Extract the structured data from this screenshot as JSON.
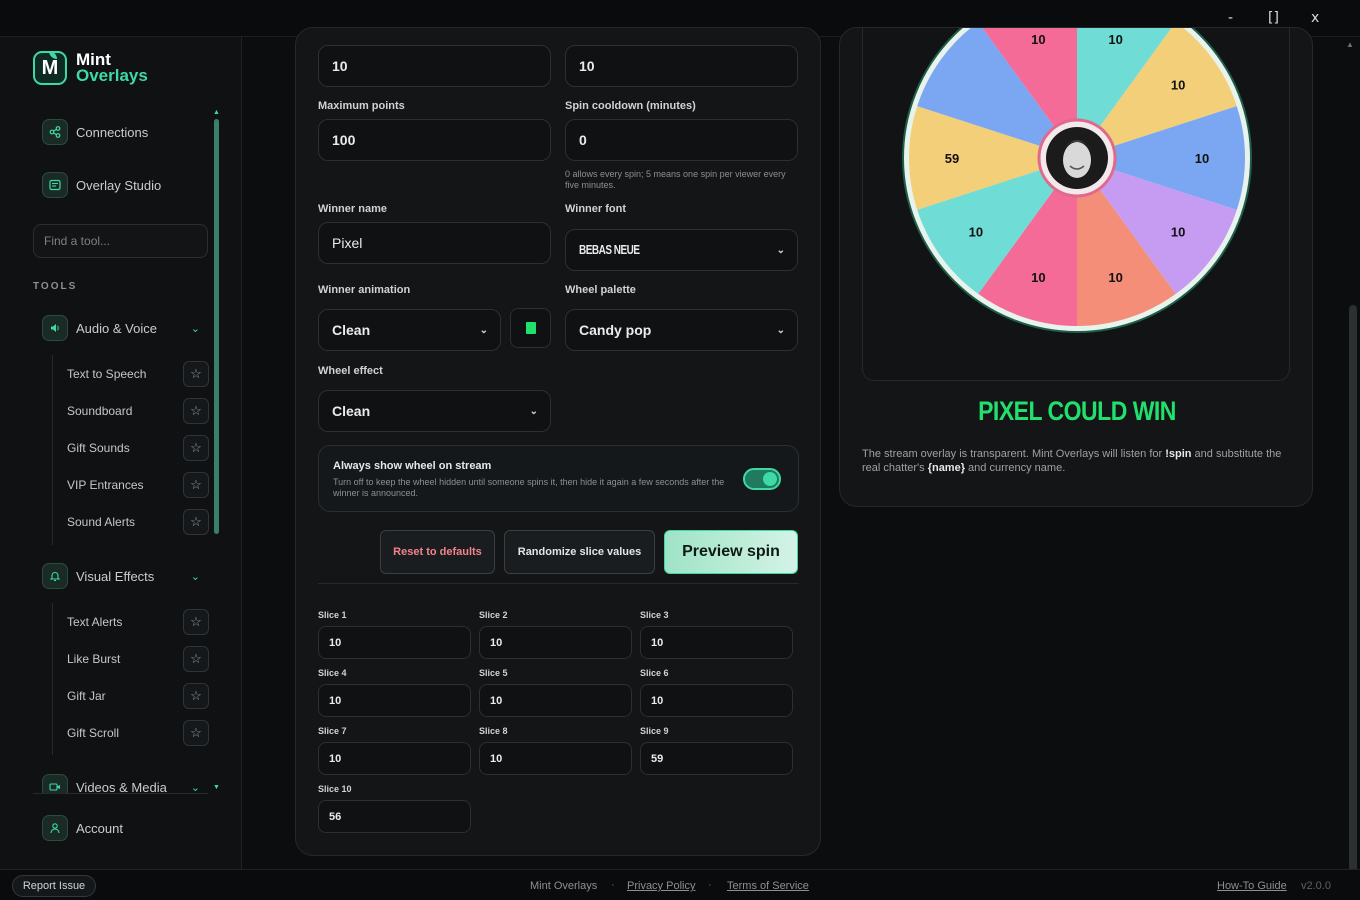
{
  "window": {
    "minimize": "-",
    "maximize": "[]",
    "close": "x"
  },
  "brand": {
    "logo_letter": "M",
    "line1": "Mint",
    "line2": "Overlays"
  },
  "nav": {
    "connections": "Connections",
    "overlay_studio": "Overlay Studio",
    "account": "Account"
  },
  "search": {
    "placeholder": "Find a tool..."
  },
  "tools_title": "TOOLS",
  "groups": {
    "audio": {
      "label": "Audio & Voice",
      "items": [
        "Text to Speech",
        "Soundboard",
        "Gift Sounds",
        "VIP Entrances",
        "Sound Alerts"
      ]
    },
    "visual": {
      "label": "Visual Effects",
      "items": [
        "Text Alerts",
        "Like Burst",
        "Gift Jar",
        "Gift Scroll"
      ]
    },
    "videos": {
      "label": "Videos & Media"
    }
  },
  "form": {
    "top_left_value": "10",
    "top_right_value": "10",
    "max_points_label": "Maximum points",
    "max_points_value": "100",
    "cooldown_label": "Spin cooldown (minutes)",
    "cooldown_value": "0",
    "cooldown_help": "0 allows every spin; 5 means one spin per viewer every five minutes.",
    "winner_name_label": "Winner name",
    "winner_name_value": "Pixel",
    "winner_font_label": "Winner font",
    "winner_font_value": "BEBAS NEUE",
    "winner_animation_label": "Winner animation",
    "winner_animation_value": "Clean",
    "animation_color": "#22e06e",
    "wheel_palette_label": "Wheel palette",
    "wheel_palette_value": "Candy pop",
    "wheel_effect_label": "Wheel effect",
    "wheel_effect_value": "Clean",
    "toggle_title": "Always show wheel on stream",
    "toggle_desc": "Turn off to keep the wheel hidden until someone spins it, then hide it again a few seconds after the winner is announced.",
    "toggle_on": true,
    "reset_label": "Reset to defaults",
    "randomize_label": "Randomize slice values",
    "preview_label": "Preview spin",
    "slices": [
      {
        "label": "Slice 1",
        "value": "10"
      },
      {
        "label": "Slice 2",
        "value": "10"
      },
      {
        "label": "Slice 3",
        "value": "10"
      },
      {
        "label": "Slice 4",
        "value": "10"
      },
      {
        "label": "Slice 5",
        "value": "10"
      },
      {
        "label": "Slice 6",
        "value": "10"
      },
      {
        "label": "Slice 7",
        "value": "10"
      },
      {
        "label": "Slice 8",
        "value": "10"
      },
      {
        "label": "Slice 9",
        "value": "59"
      },
      {
        "label": "Slice 10",
        "value": "56"
      }
    ]
  },
  "preview": {
    "wheel_labels": [
      "59",
      "10",
      "10",
      "10",
      "10",
      "10",
      "10",
      "10",
      "10"
    ],
    "wheel_colors": [
      "#f2cf78",
      "#7aa6f2",
      "#f56b97",
      "#6fdcd5",
      "#f2cf78",
      "#7aa6f2",
      "#c59cf2",
      "#f58e78",
      "#f56b97",
      "#6fdcd5"
    ],
    "winner_text": "PIXEL COULD WIN",
    "note_before": "The stream overlay is transparent. Mint Overlays will listen for ",
    "note_cmd": "!spin",
    "note_mid": " and substitute the real chatter's ",
    "note_name": "{name}",
    "note_after": " and currency name."
  },
  "footer": {
    "report": "Report Issue",
    "brand": "Mint Overlays",
    "privacy": "Privacy Policy",
    "terms": "Terms of Service",
    "sep": "·",
    "guide": "How-To Guide",
    "version": "v2.0.0"
  }
}
